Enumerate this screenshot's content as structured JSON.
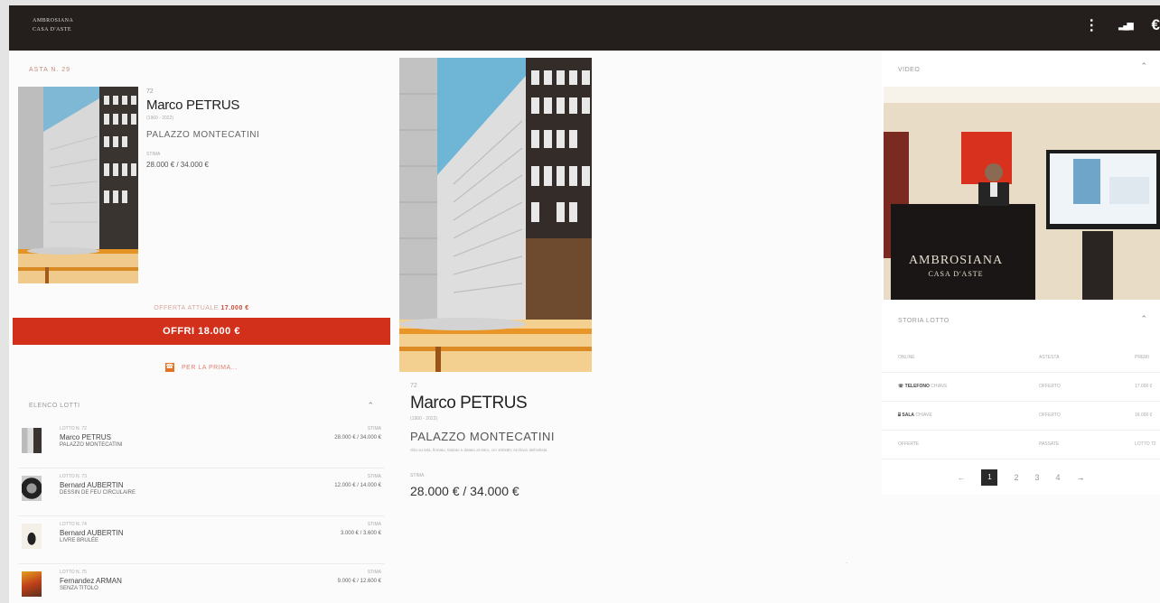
{
  "topbar": {
    "logo_line1": "AMBROSIANA",
    "logo_line2": "CASA D'ASTE",
    "icons": [
      "more-vert-icon",
      "signal-icon",
      "euro-icon"
    ],
    "icon_glyphs": [
      "⋮",
      "▂▄▆",
      "€"
    ],
    "bg_color": "#241f1d"
  },
  "left": {
    "asta_title": "ASTA N. 29",
    "current_lot": {
      "lot_number": "72",
      "artist": "Marco PETRUS",
      "dates": "(1960 - 2022)",
      "work": "PALAZZO MONTECATINI",
      "stima_label": "STIMA",
      "stima": "28.000 € / 34.000 €"
    },
    "offer_label": "OFFERTA ATTUALE",
    "offer_value": "17.000 €",
    "bid_button": "OFFRI 18.000 €",
    "bid_color": "#d3301c",
    "phone_icon_glyph": "☎",
    "phone_link": "PER LA PRIMA...",
    "elenco_title": "ELENCO LOTTI",
    "elenco_caret": "⌃",
    "lots": [
      {
        "lot": "LOTTO N. 72",
        "artist": "Marco PETRUS",
        "work": "PALAZZO MONTECATINI",
        "stima_label": "STIMA",
        "stima": "28.000 € / 34.000 €"
      },
      {
        "lot": "LOTTO N. 73",
        "artist": "Bernard AUBERTIN",
        "work": "DESSIN DE FEU CIRCULAIRE",
        "stima_label": "STIMA",
        "stima": "12.000 € / 14.000 €"
      },
      {
        "lot": "LOTTO N. 74",
        "artist": "Bernard AUBERTIN",
        "work": "LIVRE BRULÉE",
        "stima_label": "STIMA",
        "stima": "3.000 € / 3.600 €"
      },
      {
        "lot": "LOTTO N. 75",
        "artist": "Fernandez ARMAN",
        "work": "SENZA TITOLO",
        "stima_label": "STIMA",
        "stima": "9.000 € / 12.600 €"
      }
    ]
  },
  "middle": {
    "lot_number": "72",
    "artist": "Marco PETRUS",
    "dates": "(1960 - 2022)",
    "work": "PALAZZO MONTECATINI",
    "description": "Olio su tela, firmato, titolato e datato al retro, cm 100x80, Archivio dell'artista",
    "stima_label": "STIMA",
    "stima": "28.000 € / 34.000 €",
    "dot": "·"
  },
  "right": {
    "video_label": "VIDEO",
    "video_caret": "⌃",
    "video_sign_line1": "AMBROSIANA",
    "video_sign_line2": "CASA D'ASTE",
    "storia_label": "STORIA LOTTO",
    "storia_caret": "⌃",
    "storia_rows": [
      {
        "c1": "ONLINE",
        "c2": "ASTESTA",
        "c3": "PREMI"
      },
      {
        "icon": "☏",
        "c1_bold": "TELEFONO",
        "c1": "CHIAVE",
        "c2": "OFFERTO",
        "c3": "17.000 €"
      },
      {
        "icon": "⌸",
        "c1_bold": "SALA",
        "c1": "CHIAVE",
        "c2": "OFFERTO",
        "c3": "16.000 €"
      },
      {
        "c1": "OFFERTE",
        "c2": "PASSATE",
        "c3": "LOTTO 72"
      }
    ],
    "pager": {
      "prev": "←",
      "pages": [
        "1",
        "2",
        "3",
        "4"
      ],
      "active": "1",
      "next": "→"
    }
  }
}
